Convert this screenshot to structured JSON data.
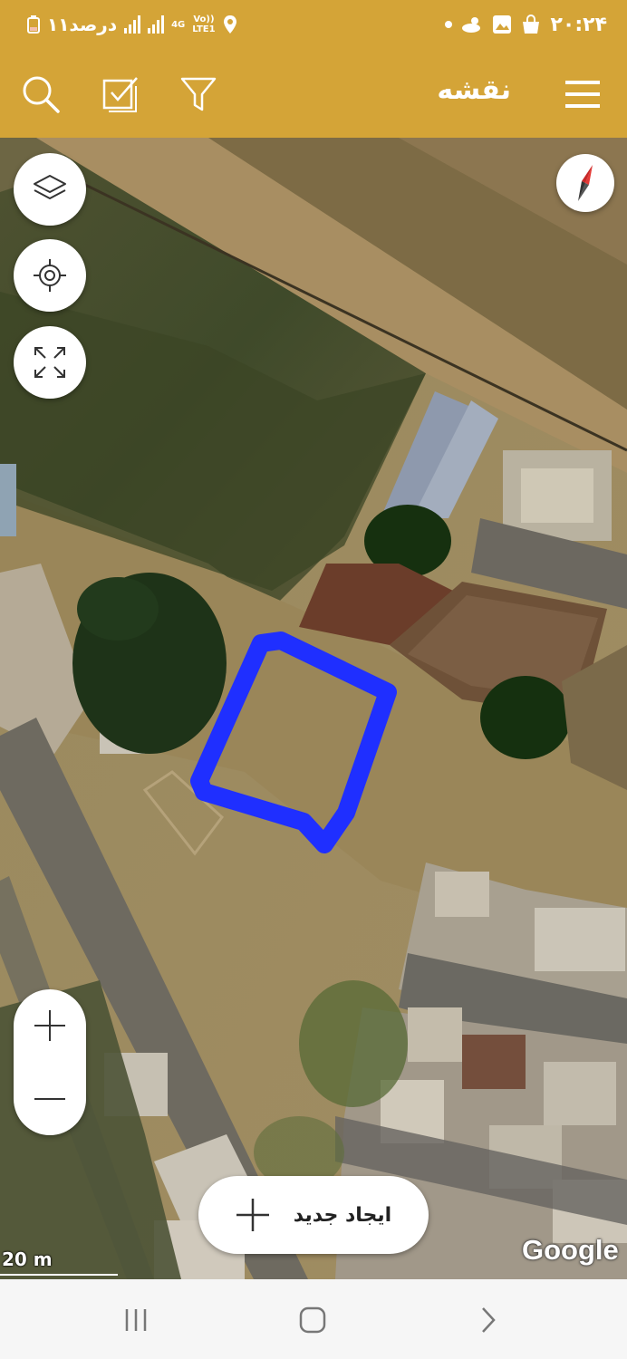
{
  "status_bar": {
    "time": "۲۰:۲۴",
    "battery_text": "۱۱درصد",
    "network_4g": "4G",
    "network_volte_top": "Vo))",
    "network_volte_bottom": "LTE1"
  },
  "app_bar": {
    "title": "نقشه",
    "icons": [
      "menu-icon",
      "filter-icon",
      "checklist-icon",
      "search-icon"
    ]
  },
  "map": {
    "controls": [
      "layers-icon",
      "my-location-icon",
      "fullscreen-icon",
      "compass-icon"
    ],
    "zoom_in_icon": "plus-icon",
    "zoom_out_icon": "minus-icon",
    "create_button_label": "ایجاد جدید",
    "provider": "Google",
    "scale_label": "20 m",
    "drawn_polygon_color": "#1f2fff"
  },
  "nav_bar": {
    "icons": [
      "recent-apps-icon",
      "home-icon",
      "back-icon"
    ]
  },
  "colors": {
    "accent": "#d4a437",
    "nav_background": "#f6f6f6"
  }
}
